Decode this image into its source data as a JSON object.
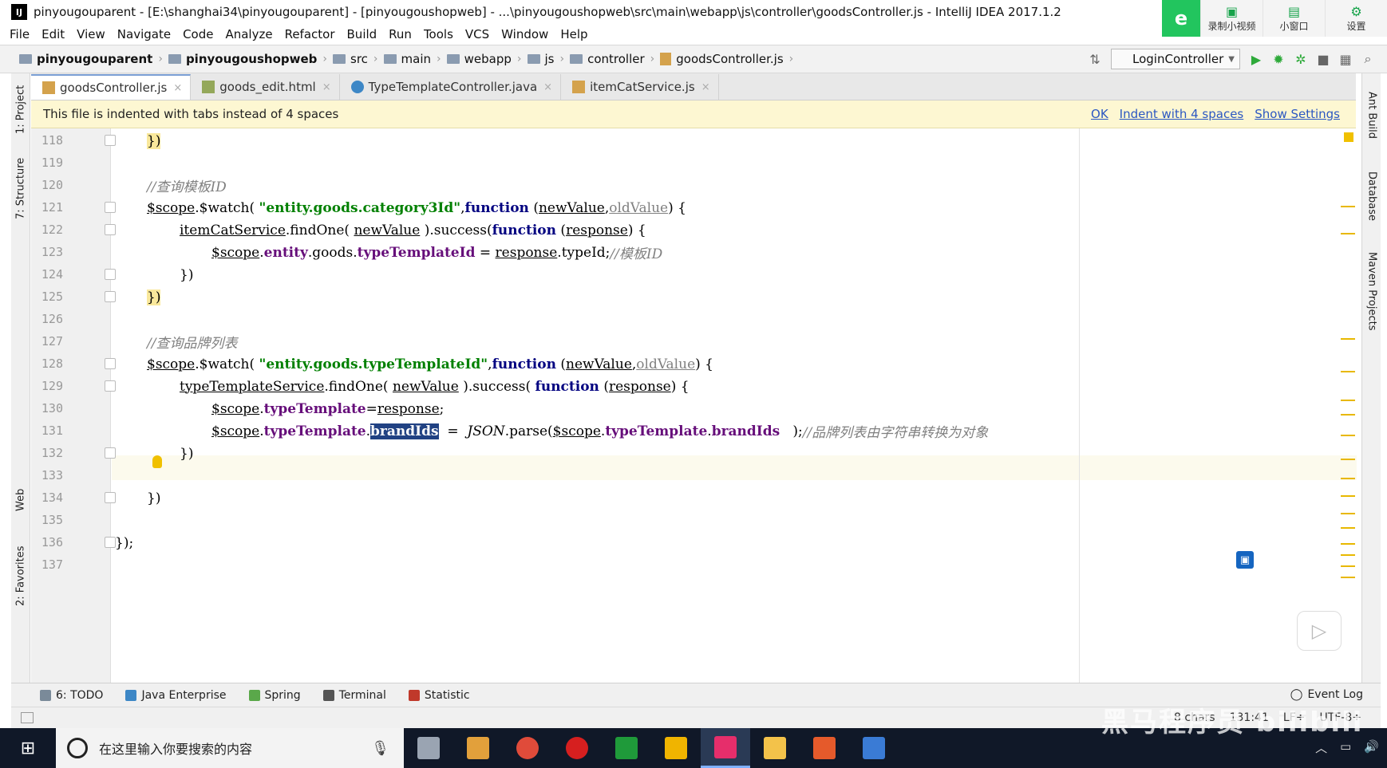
{
  "window": {
    "title": "pinyougouparent - [E:\\shanghai34\\pinyougouparent] - [pinyougoushopweb] - ...\\pinyougoushopweb\\src\\main\\webapp\\js\\controller\\goodsController.js - IntelliJ IDEA 2017.1.2",
    "app_icon": "IJ"
  },
  "overlay": {
    "logo": "e",
    "buttons": [
      {
        "label": "录制小视频",
        "icon": "record-icon"
      },
      {
        "label": "小窗口",
        "icon": "window-icon"
      },
      {
        "label": "设置",
        "icon": "settings-icon"
      }
    ]
  },
  "menu": [
    "File",
    "Edit",
    "View",
    "Navigate",
    "Code",
    "Analyze",
    "Refactor",
    "Build",
    "Run",
    "Tools",
    "VCS",
    "Window",
    "Help"
  ],
  "breadcrumb": [
    "pinyougouparent",
    "pinyougoushopweb",
    "src",
    "main",
    "webapp",
    "js",
    "controller",
    "goodsController.js"
  ],
  "run_config": "LoginController",
  "tabs": [
    {
      "label": "goodsController.js",
      "active": true
    },
    {
      "label": "goods_edit.html",
      "active": false
    },
    {
      "label": "TypeTemplateController.java",
      "active": false
    },
    {
      "label": "itemCatService.js",
      "active": false
    }
  ],
  "notification": {
    "message": "This file is indented with tabs instead of 4 spaces",
    "actions": [
      "OK",
      "Indent with 4 spaces",
      "Show Settings"
    ]
  },
  "left_tools": [
    "1: Project",
    "7: Structure",
    "Web",
    "2: Favorites"
  ],
  "right_tools": [
    "Ant Build",
    "Database",
    "Maven Projects"
  ],
  "editor": {
    "line_numbers": [
      "118",
      "119",
      "120",
      "121",
      "122",
      "123",
      "124",
      "125",
      "126",
      "127",
      "128",
      "129",
      "130",
      "131",
      "132",
      "133",
      "134",
      "135",
      "136",
      "137"
    ],
    "current_line": "131",
    "code": {
      "l118": "})",
      "l120": "//查询模板ID",
      "l121_a": "$scope",
      "l121_b": ".$watch( ",
      "l121_c": "\"entity.goods.category3Id\"",
      "l121_d": ",",
      "l121_e": "function",
      "l121_f": " (",
      "l121_g": "newValue",
      "l121_h": ",",
      "l121_i": "oldValue",
      "l121_j": ") {",
      "l122_a": "itemCatService",
      "l122_b": ".findOne( ",
      "l122_c": "newValue",
      "l122_d": " ).success(",
      "l122_e": "function",
      "l122_f": " (",
      "l122_g": "response",
      "l122_h": ") {",
      "l123_a": "$scope",
      "l123_b": ".",
      "l123_c": "entity",
      "l123_d": ".goods.",
      "l123_e": "typeTemplateId",
      "l123_f": " = ",
      "l123_g": "response",
      "l123_h": ".typeId;",
      "l123_i": "//模板ID",
      "l124": "})",
      "l125": "})",
      "l127": "//查询品牌列表",
      "l128_a": "$scope",
      "l128_b": ".$watch( ",
      "l128_c": "\"entity.goods.typeTemplateId\"",
      "l128_d": ",",
      "l128_e": "function",
      "l128_f": " (",
      "l128_g": "newValue",
      "l128_h": ",",
      "l128_i": "oldValue",
      "l128_j": ") {",
      "l129_a": "typeTemplateService",
      "l129_b": ".findOne( ",
      "l129_c": "newValue",
      "l129_d": " ).success( ",
      "l129_e": "function",
      "l129_f": " (",
      "l129_g": "response",
      "l129_h": ") {",
      "l130_a": "$scope",
      "l130_b": ".",
      "l130_c": "typeTemplate",
      "l130_d": "=",
      "l130_e": "response",
      "l130_f": ";",
      "l131_a": "$scope",
      "l131_b": ".",
      "l131_c": "typeTemplate",
      "l131_d": ".",
      "l131_e": "brandIds",
      "l131_f": "  =  ",
      "l131_g": "JSON",
      "l131_h": ".parse(",
      "l131_i": "$scope",
      "l131_j": ".",
      "l131_k": "typeTemplate",
      "l131_l": ".",
      "l131_m": "brandIds",
      "l131_n": "   );",
      "l131_o": "//品牌列表由字符串转换为对象",
      "l132": "})",
      "l134": "})",
      "l136": "});"
    }
  },
  "tool_windows": [
    {
      "label": "6: TODO",
      "color": "#7a8a99"
    },
    {
      "label": "Java Enterprise",
      "color": "#3d87c6"
    },
    {
      "label": "Spring",
      "color": "#5aa84a"
    },
    {
      "label": "Terminal",
      "color": "#555555"
    },
    {
      "label": "Statistic",
      "color": "#c0392b"
    }
  ],
  "event_log": "Event Log",
  "status": {
    "chars": "8 chars",
    "position": "131:41",
    "line_sep": "LF÷",
    "encoding": "UTF-8÷"
  },
  "taskbar": {
    "search_placeholder": "在这里输入你要搜索的内容",
    "apps": [
      {
        "name": "task-view",
        "color": "#9aa4b2"
      },
      {
        "name": "app-1",
        "color": "#e2a03b"
      },
      {
        "name": "chrome",
        "color": "#e04b3a"
      },
      {
        "name": "app-red",
        "color": "#d61f1f"
      },
      {
        "name": "app-green",
        "color": "#1f9a3a"
      },
      {
        "name": "app-blue",
        "color": "#f0b400"
      },
      {
        "name": "intellij",
        "color": "#e62e6b"
      },
      {
        "name": "explorer",
        "color": "#f3c24a"
      },
      {
        "name": "pdf",
        "color": "#e55a2b"
      },
      {
        "name": "app-arrow",
        "color": "#3a7bd5"
      }
    ]
  },
  "watermark": "黑马程序员 bilibili"
}
